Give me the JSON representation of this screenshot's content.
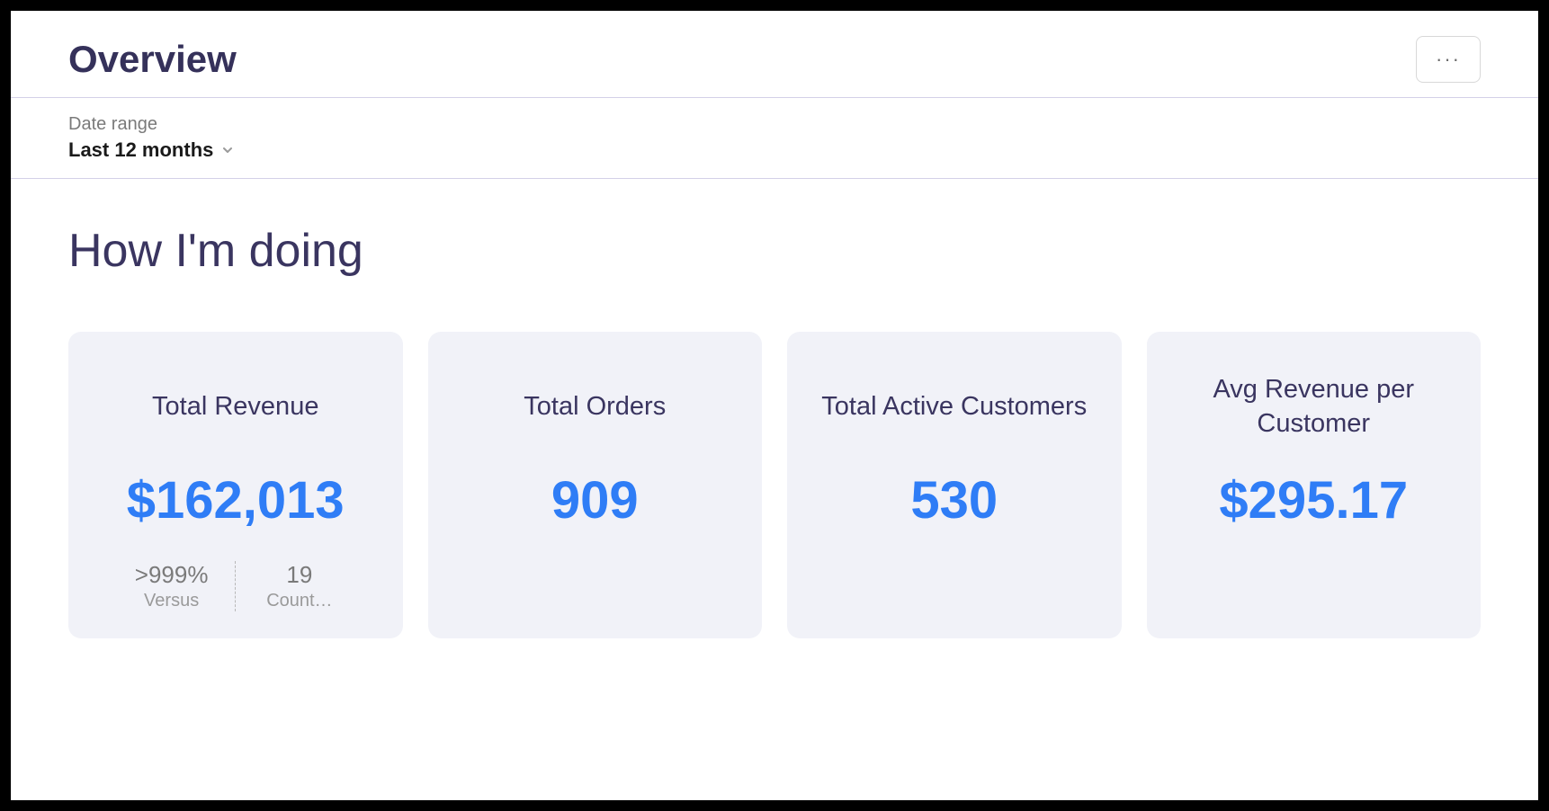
{
  "page": {
    "title": "Overview"
  },
  "filter": {
    "label": "Date range",
    "value": "Last 12 months"
  },
  "section": {
    "title": "How I'm doing"
  },
  "cards": {
    "revenue": {
      "title": "Total Revenue",
      "value": "$162,013",
      "footer": {
        "left_value": ">999%",
        "left_label": "Versus",
        "right_value": "19",
        "right_label": "Count…"
      }
    },
    "orders": {
      "title": "Total Orders",
      "value": "909"
    },
    "customers": {
      "title": "Total Active Customers",
      "value": "530"
    },
    "avg_revenue": {
      "title": "Avg Revenue per Customer",
      "value": "$295.17"
    }
  }
}
